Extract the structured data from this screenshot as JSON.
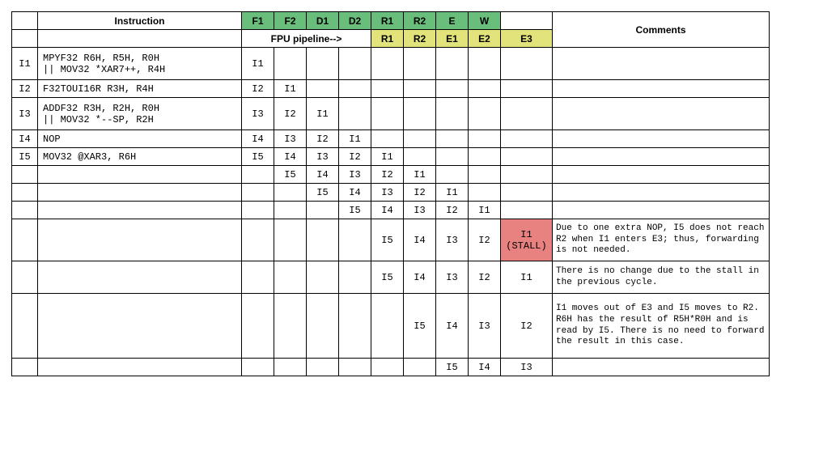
{
  "headers": {
    "instruction": "Instruction",
    "stages": [
      "F1",
      "F2",
      "D1",
      "D2",
      "R1",
      "R2",
      "E",
      "W"
    ],
    "fpu_label": "FPU pipeline-->",
    "fpu_stages": [
      "R1",
      "R2",
      "E1",
      "E2",
      "E3"
    ],
    "comments": "Comments"
  },
  "rows": [
    {
      "idx": "I1",
      "instr": "MPYF32 R6H, R5H, R0H\n|| MOV32 *XAR7++, R4H",
      "cells": [
        "I1",
        "",
        "",
        "",
        "",
        "",
        "",
        "",
        ""
      ],
      "comment": "",
      "h": "tall"
    },
    {
      "idx": "I2",
      "instr": "F32TOUI16R R3H, R4H",
      "cells": [
        "I2",
        "I1",
        "",
        "",
        "",
        "",
        "",
        "",
        ""
      ],
      "comment": "",
      "h": ""
    },
    {
      "idx": "I3",
      "instr": "ADDF32 R3H, R2H, R0H\n|| MOV32 *--SP, R2H",
      "cells": [
        "I3",
        "I2",
        "I1",
        "",
        "",
        "",
        "",
        "",
        ""
      ],
      "comment": "",
      "h": "tall"
    },
    {
      "idx": "I4",
      "instr": "NOP",
      "cells": [
        "I4",
        "I3",
        "I2",
        "I1",
        "",
        "",
        "",
        "",
        ""
      ],
      "comment": "",
      "h": ""
    },
    {
      "idx": "I5",
      "instr": "MOV32 @XAR3, R6H",
      "cells": [
        "I5",
        "I4",
        "I3",
        "I2",
        "I1",
        "",
        "",
        "",
        ""
      ],
      "comment": "",
      "h": ""
    },
    {
      "idx": "",
      "instr": "",
      "cells": [
        "",
        "I5",
        "I4",
        "I3",
        "I2",
        "I1",
        "",
        "",
        ""
      ],
      "comment": "",
      "h": ""
    },
    {
      "idx": "",
      "instr": "",
      "cells": [
        "",
        "",
        "I5",
        "I4",
        "I3",
        "I2",
        "I1",
        "",
        ""
      ],
      "comment": "",
      "h": ""
    },
    {
      "idx": "",
      "instr": "",
      "cells": [
        "",
        "",
        "",
        "I5",
        "I4",
        "I3",
        "I2",
        "I1",
        ""
      ],
      "comment": "",
      "h": ""
    },
    {
      "idx": "",
      "instr": "",
      "cells": [
        "",
        "",
        "",
        "",
        "I5",
        "I4",
        "I3",
        "I2",
        "I1\n(STALL)"
      ],
      "comment": "Due to one extra NOP, I5 does not reach R2 when I1 enters E3; thus, forwarding is not needed.",
      "stall_col": 8,
      "h": "taller"
    },
    {
      "idx": "",
      "instr": "",
      "cells": [
        "",
        "",
        "",
        "",
        "I5",
        "I4",
        "I3",
        "I2",
        "I1"
      ],
      "comment": "There is no change due to the stall in the previous cycle.",
      "h": "tall"
    },
    {
      "idx": "",
      "instr": "",
      "cells": [
        "",
        "",
        "",
        "",
        "",
        "I5",
        "I4",
        "I3",
        "I2"
      ],
      "comment": "I1 moves out of E3 and I5 moves to R2. R6H has the result of R5H*R0H and is read by I5. There is no need to forward the result in this case.",
      "h": "tallest"
    },
    {
      "idx": "",
      "instr": "",
      "cells": [
        "",
        "",
        "",
        "",
        "",
        "",
        "I5",
        "I4",
        "I3"
      ],
      "comment": "",
      "h": ""
    }
  ]
}
